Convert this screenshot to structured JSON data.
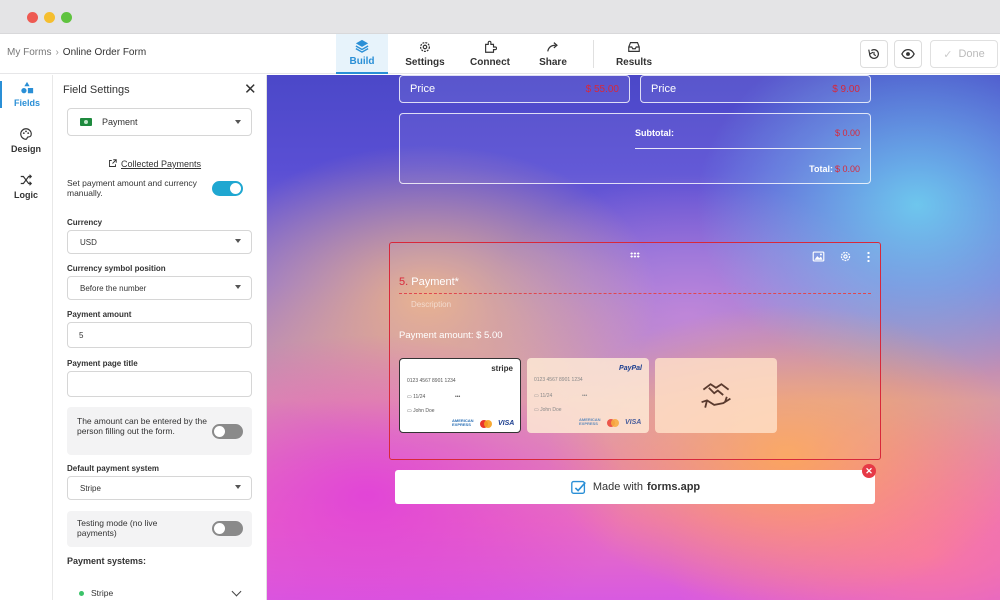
{
  "breadcrumb": {
    "parent": "My Forms",
    "separator": "›",
    "current": "Online Order Form"
  },
  "nav": {
    "build": "Build",
    "settings": "Settings",
    "connect": "Connect",
    "share": "Share",
    "results": "Results"
  },
  "toolbar": {
    "done_label": "Done"
  },
  "rail": {
    "fields": "Fields",
    "design": "Design",
    "logic": "Logic"
  },
  "panel": {
    "title": "Field Settings",
    "field_type": "Payment",
    "collected_link": "Collected Payments",
    "manual_text": "Set payment amount and currency manually.",
    "manual_on": true,
    "currency_label": "Currency",
    "currency_value": "USD",
    "symbol_pos_label": "Currency symbol position",
    "symbol_pos_value": "Before the number",
    "amount_label": "Payment amount",
    "amount_value": "5",
    "page_title_label": "Payment page title",
    "page_title_value": "",
    "editable_text": "The amount can be entered by the person filling out the form.",
    "editable_on": false,
    "default_system_label": "Default payment system",
    "default_system_value": "Stripe",
    "testing_text": "Testing mode (no live payments)",
    "testing_on": false,
    "systems_label": "Payment systems:",
    "system_item": "Stripe"
  },
  "form": {
    "price1_label": "Price",
    "price1_value": "$ 55.00",
    "price2_label": "Price",
    "price2_value": "$ 9.00",
    "subtotal_label": "Subtotal:",
    "subtotal_value": "$ 0.00",
    "total_label": "Total:",
    "total_value": "$ 0.00",
    "q_number": "5.",
    "q_title": "Payment*",
    "q_description": "Description",
    "amount_text": "Payment amount: $ 5.00",
    "stripe_card": {
      "brand": "stripe",
      "number": "0123 4567 8901 1234",
      "name": "John Doe"
    },
    "paypal_card": {
      "brand": "PayPal",
      "number": "0123 4567 8901 1234",
      "name": "John Doe"
    },
    "card_logos": {
      "amex": "AMERICAN EXPRESS",
      "visa": "VISA"
    },
    "made_with": "Made with",
    "made_brand": "forms.app"
  },
  "colors": {
    "accent": "#2a8fd6",
    "toggle_on": "#1fa7d1",
    "error": "#d8283a"
  }
}
